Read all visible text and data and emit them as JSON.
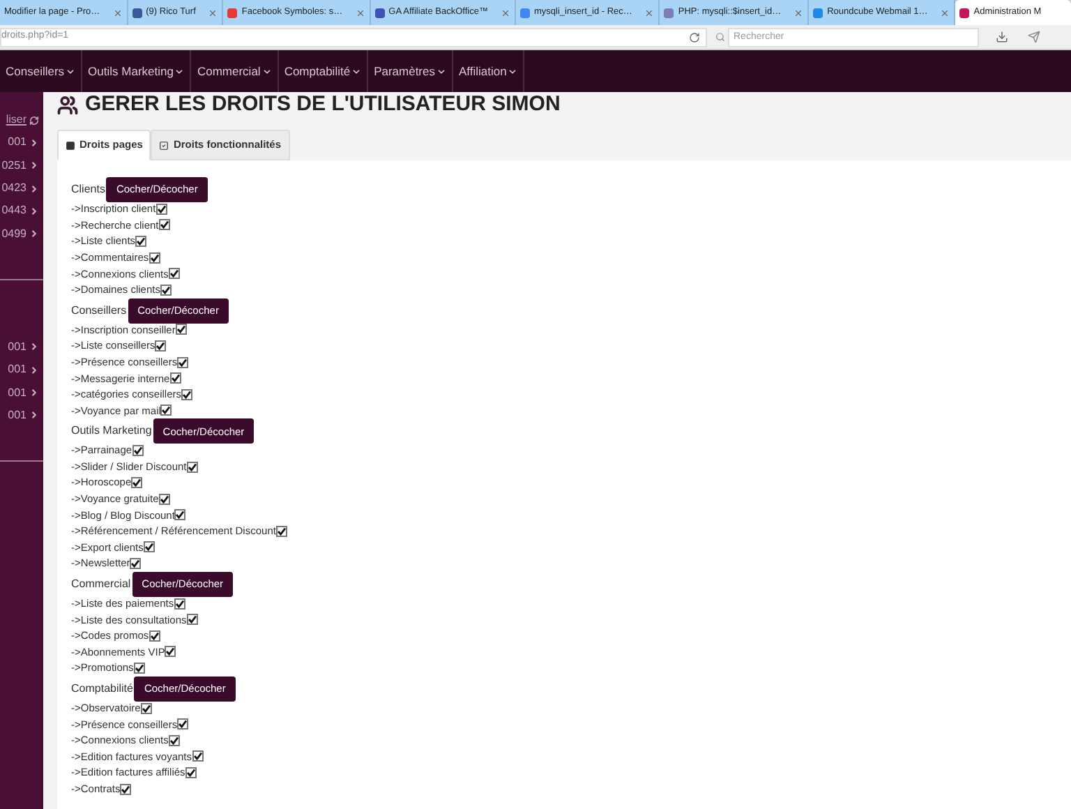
{
  "browser": {
    "tabs": [
      {
        "title": "Modifier la page - Pro…",
        "selected": false
      },
      {
        "title": "(9) Rico Turf",
        "selected": false,
        "color": "#3b5998"
      },
      {
        "title": "Facebook Symboles: s…",
        "selected": false,
        "color": "#e53935"
      },
      {
        "title": "GA Affiliate BackOffice™",
        "selected": false,
        "color": "#3f51b5"
      },
      {
        "title": "mysqli_insert_id - Rec…",
        "selected": false,
        "color": "#4285f4"
      },
      {
        "title": "PHP: mysqli::$insert_id…",
        "selected": false,
        "color": "#7b7fb5"
      },
      {
        "title": "Roundcube Webmail 1…",
        "selected": false,
        "color": "#1e88e5"
      },
      {
        "title": "Administration M",
        "selected": true,
        "color": "#c2185b"
      }
    ],
    "url": "droits.php?id=1",
    "search": {
      "placeholder": "Rechercher"
    }
  },
  "nav": {
    "menu": [
      "Conseillers",
      "Outils Marketing",
      "Commercial",
      "Comptabilité",
      "Paramètres",
      "Affiliation"
    ]
  },
  "sidebar": {
    "groups": [
      {
        "items": [
          {
            "label": "liser",
            "kind": "refresh"
          },
          {
            "label": "001",
            "kind": "chevron"
          },
          {
            "label": "0251",
            "kind": "chevron"
          },
          {
            "label": "0423",
            "kind": "chevron"
          },
          {
            "label": "0443",
            "kind": "chevron"
          },
          {
            "label": "0499",
            "kind": "chevron"
          }
        ]
      },
      {
        "items": [
          {
            "label": "001",
            "kind": "chevron"
          },
          {
            "label": "001",
            "kind": "chevron"
          },
          {
            "label": "001",
            "kind": "chevron"
          },
          {
            "label": "001",
            "kind": "chevron"
          }
        ]
      }
    ]
  },
  "page": {
    "title": "GERER LES DROITS DE L'UTILISATEUR SIMON",
    "tabs": [
      {
        "label": "Droits pages",
        "selected": true,
        "kind": "pages"
      },
      {
        "label": "Droits fonctionnalités",
        "selected": false,
        "kind": "features"
      }
    ],
    "sections": [
      {
        "title": "Clients",
        "button": "Cocher/Décocher",
        "items": [
          {
            "label": "->Inscription client",
            "checked": true
          },
          {
            "label": "->Recherche client",
            "checked": true
          },
          {
            "label": "->Liste clients",
            "checked": true
          },
          {
            "label": "->Commentaires",
            "checked": true
          },
          {
            "label": "->Connexions clients",
            "checked": true
          },
          {
            "label": "->Domaines clients",
            "checked": true
          }
        ]
      },
      {
        "title": "Conseillers",
        "button": "Cocher/Décocher",
        "items": [
          {
            "label": "->Inscription conseiller",
            "checked": true
          },
          {
            "label": "->Liste conseillers",
            "checked": true
          },
          {
            "label": "->Présence conseillers",
            "checked": true
          },
          {
            "label": "->Messagerie interne",
            "checked": true
          },
          {
            "label": "->catégories conseillers",
            "checked": true
          },
          {
            "label": "->Voyance par mail",
            "checked": true
          }
        ]
      },
      {
        "title": "Outils Marketing",
        "button": "Cocher/Décocher",
        "items": [
          {
            "label": "->Parrainage",
            "checked": true
          },
          {
            "label": "->Slider / Slider Discount",
            "checked": true
          },
          {
            "label": "->Horoscope",
            "checked": true
          },
          {
            "label": "->Voyance gratuite",
            "checked": true
          },
          {
            "label": "->Blog / Blog Discount",
            "checked": true
          },
          {
            "label": "->Référencement / Référencement Discount",
            "checked": true
          },
          {
            "label": "->Export clients",
            "checked": true
          },
          {
            "label": "->Newsletter",
            "checked": true
          }
        ]
      },
      {
        "title": "Commercial",
        "button": "Cocher/Décocher",
        "items": [
          {
            "label": "->Liste des paiements",
            "checked": true
          },
          {
            "label": "->Liste des consultations",
            "checked": true
          },
          {
            "label": "->Codes promos",
            "checked": true
          },
          {
            "label": "->Abonnements VIP",
            "checked": true
          },
          {
            "label": "->Promotions",
            "checked": true
          }
        ]
      },
      {
        "title": "Comptabilité",
        "button": "Cocher/Décocher",
        "items": [
          {
            "label": "->Observatoire",
            "checked": true
          },
          {
            "label": "->Présence conseillers",
            "checked": true
          },
          {
            "label": "->Connexions clients",
            "checked": true
          },
          {
            "label": "->Edition factures voyants",
            "checked": true
          },
          {
            "label": "->Edition factures affiliés",
            "checked": true
          },
          {
            "label": "->Contrats",
            "checked": true
          }
        ]
      }
    ]
  }
}
